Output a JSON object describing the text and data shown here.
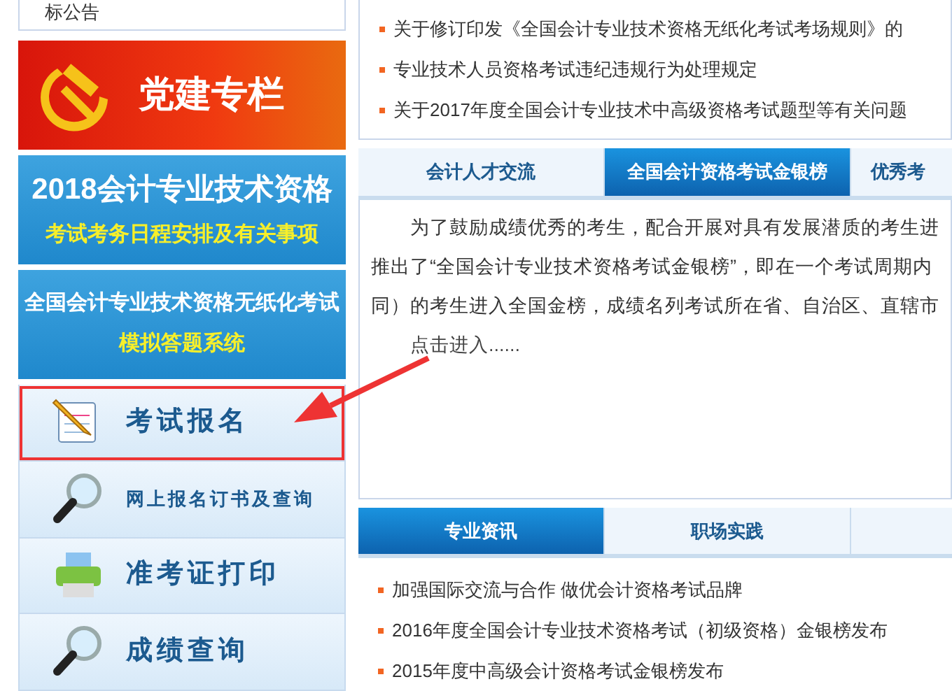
{
  "notice_box": {
    "text": "标公告"
  },
  "banners": [
    {
      "kind": "party",
      "title": "党建专栏"
    },
    {
      "kind": "schedule",
      "title": "2018会计专业技术资格",
      "subtitle": "考试考务日程安排及有关事项"
    },
    {
      "kind": "mock",
      "title": "全国会计专业技术资格无纸化考试",
      "subtitle": "模拟答题系统"
    }
  ],
  "menu": [
    {
      "kind": "register",
      "label": "考试报名",
      "highlighted": true
    },
    {
      "kind": "search",
      "label": "网上报名订书及查询",
      "highlighted": false
    },
    {
      "kind": "print",
      "label": "准考证打印",
      "highlighted": false
    },
    {
      "kind": "search",
      "label": "成绩查询",
      "highlighted": false
    }
  ],
  "news": [
    "关于修订印发《全国会计专业技术资格无纸化考试考场规则》的",
    "专业技术人员资格考试违纪违规行为处理规定",
    "关于2017年度全国会计专业技术中高级资格考试题型等有关问题"
  ],
  "tabs": [
    {
      "label": "会计人才交流",
      "selected": false
    },
    {
      "label": "全国会计资格考试金银榜",
      "selected": true
    },
    {
      "label": "优秀考",
      "selected": false
    }
  ],
  "panel_text": [
    "为了鼓励成绩优秀的考生，配合开展对具有发展潜质的考生进",
    "推出了“全国会计专业技术资格考试金银榜”，即在一个考试周期内",
    "同）的考生进入全国金榜，成绩名列考试所在省、自治区、直辖市"
  ],
  "panel_link": "点击进入......",
  "tabs_2": [
    {
      "label": "专业资讯",
      "selected": true
    },
    {
      "label": "职场实践",
      "selected": false
    }
  ],
  "news_2": [
    "加强国际交流与合作  做优会计资格考试品牌",
    "2016年度全国会计专业技术资格考试（初级资格）金银榜发布",
    "2015年度中高级会计资格考试金银榜发布"
  ],
  "annotation_arrow": true
}
